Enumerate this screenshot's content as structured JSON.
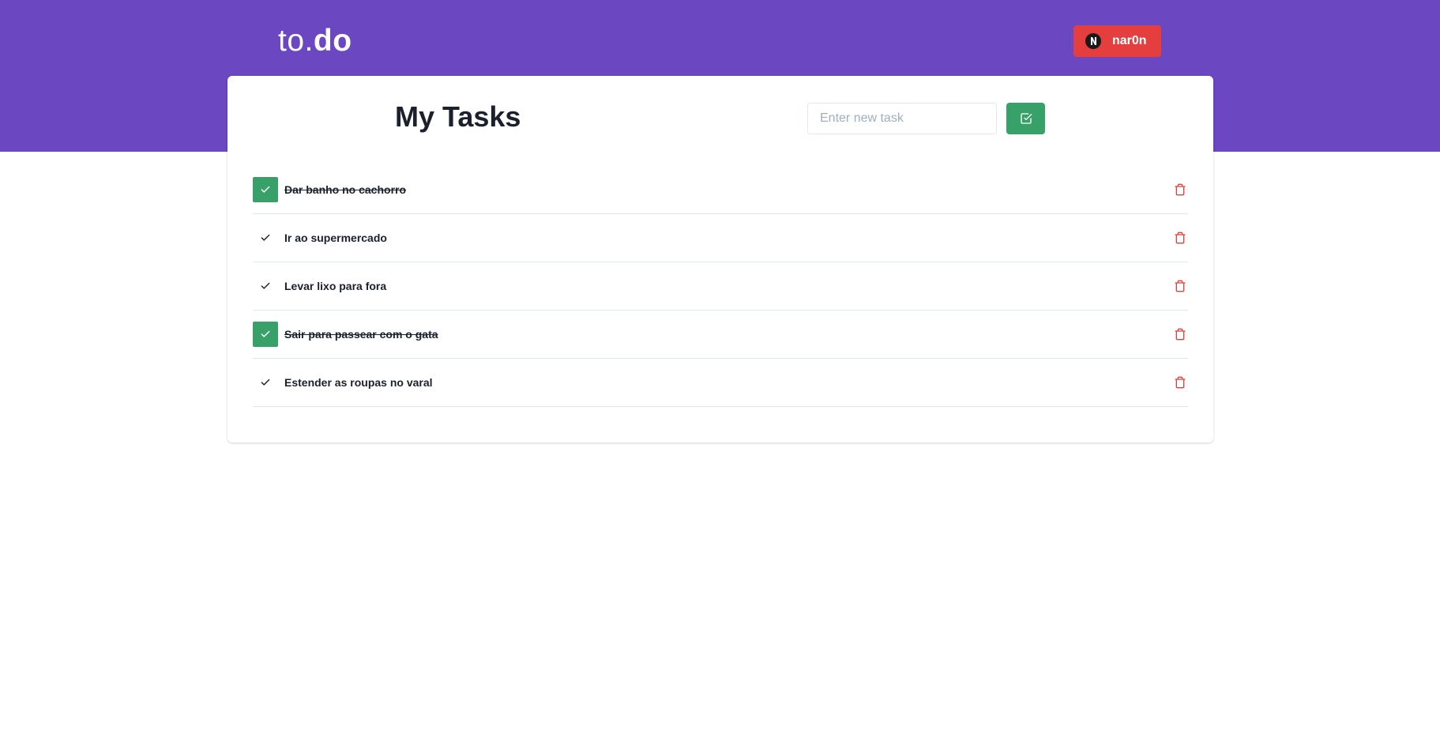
{
  "header": {
    "logo_light": "to.",
    "logo_bold": "do",
    "user": {
      "name": "nar0n",
      "avatar_icon": "avatar-icon",
      "color": "#e53e3e"
    },
    "background_color": "#6b47c2"
  },
  "main": {
    "title": "My Tasks",
    "new_task": {
      "placeholder": "Enter new task",
      "value": ""
    },
    "add_button_icon": "check-square-icon",
    "accent_color": "#38a169",
    "tasks": [
      {
        "label": "Dar banho no cachorro",
        "done": true
      },
      {
        "label": "Ir ao supermercado",
        "done": false
      },
      {
        "label": "Levar lixo para fora",
        "done": false
      },
      {
        "label": "Sair para passear com o gata",
        "done": true
      },
      {
        "label": "Estender as roupas no varal",
        "done": false
      }
    ],
    "delete_icon": "trash-icon",
    "delete_color": "#e53e3e"
  }
}
